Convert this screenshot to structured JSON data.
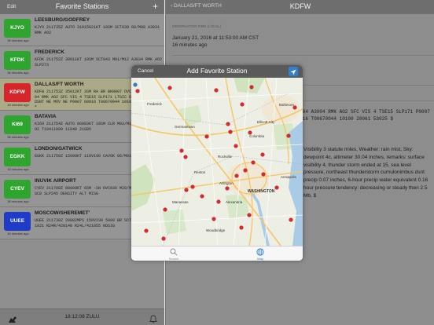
{
  "left": {
    "edit_label": "Edit",
    "title": "Favorite Stations",
    "add_label": "+",
    "stations": [
      {
        "code": "KJYO",
        "color": "#2fa52f",
        "ago": "36 minutes ago",
        "name": "LEESBURG/GODFREY",
        "metar": "KJYO 211735Z AUTO 31015G21KT 10SM SCT039 00/M08 A3031 RMK AO2",
        "selected": false
      },
      {
        "code": "KFDK",
        "color": "#2fa52f",
        "ago": "36 minutes ago",
        "name": "FREDERICK",
        "metar": "KFDK 211752Z 30011KT 10SM SCT043 M01/M12 A3034 RMK AO2 SLP273",
        "selected": false
      },
      {
        "code": "KDFW",
        "color": "#d6252b",
        "ago": "16 minutes ago",
        "name": "DALLAS/FT WORTH",
        "metar": "KDFW 211753Z 35012KT 3SM RA BR BKN007 OVC012 07/04 A3004 RMK AO2 SFC VIS 4 TSE15 SLP171 LTGIC DSNT NE TS CB DSNT NE MOV NE P0007 60016 T00670044 10100 20061 53025 $",
        "selected": true
      },
      {
        "code": "KI69",
        "color": "#2fa52f",
        "ago": "36 minutes ago",
        "name": "BATAVIA",
        "metar": "KI69 211754Z AUTO 06003KT 10SM CLR M03/M11 A3034 RMK AO2 T10411099 11040 21085",
        "selected": false
      },
      {
        "code": "EGKK",
        "color": "#2fa52f",
        "ago": "16 minutes ago",
        "name": "LONDON/GATWICK",
        "metar": "EGKK 211750Z 15008KT 110V190 CAVOK 06/M01 Q1029",
        "selected": false
      },
      {
        "code": "CYEV",
        "color": "#2fa52f",
        "ago": "36 minutes ago",
        "name": "INUVIK AIRPORT",
        "metar": "CYEV 211700Z 00000KT 6SM -SN OVC036 M28/M31 A3022 RMK SC8 SLP245 DENSITY ALT MISG",
        "selected": false
      },
      {
        "code": "UUEE",
        "color": "#1e3cc8",
        "ago": "16 minutes ago",
        "name": "MOSCOW/SHEREMET'",
        "metar": "UUEE 211730Z 20002MPS 150V230 5000 BR SCT033 M12/M13 Q1021 R24R/420140 R24L/421055 NOSIG",
        "selected": false
      }
    ],
    "clock": "18:12:08 ZULU"
  },
  "right": {
    "back_label": "DALLAS/FT WORTH",
    "title": "KDFW",
    "obs_header": "OBSERVATION TIME (LOCAL)",
    "obs_time": "January 21, 2016 at 11:53:00 AM CST",
    "obs_ago": "16 minutes ago",
    "raw_metar": "07/04 A3004 RMK AO2 SFC VIS 4 TSE15 SLP171 P0007 60016 T00670044 10100 20061 53025 $",
    "decoded": "Visibility 3 statute miles, Weather: rain mist, Sky: dewpoint 4c, altimeter 30.04 inches, remarks: surface visibility 4, thunder storm ended at 15, sea level pressure, northeast thunderstorm cumulonimbus dsnt precip 0.07 inches, 6-hour precip water equivalent 0.16 hour pressure tendency: decreasing or steady then 2.5 Mb, $"
  },
  "modal": {
    "cancel_label": "Cancel",
    "title": "Add Favorite Station",
    "map_labels": {
      "germantown": "Germantown",
      "columbia": "Columbia",
      "ellicott": "Ellicott City",
      "rockville": "Rockville",
      "reston": "Reston",
      "arlington": "Arlington",
      "washington": "WASHINGTON",
      "alexandria": "Alexandria",
      "annapolis": "Annapolis",
      "manassas": "Manassas",
      "frederick": "Frederick",
      "baltimore": "Baltimore",
      "woodbridge": "Woodbridge"
    },
    "tabs": {
      "search": "Search",
      "map": "Map"
    }
  },
  "colors": {
    "accent": "#2f80d0",
    "selected_row": "#aaa988"
  }
}
